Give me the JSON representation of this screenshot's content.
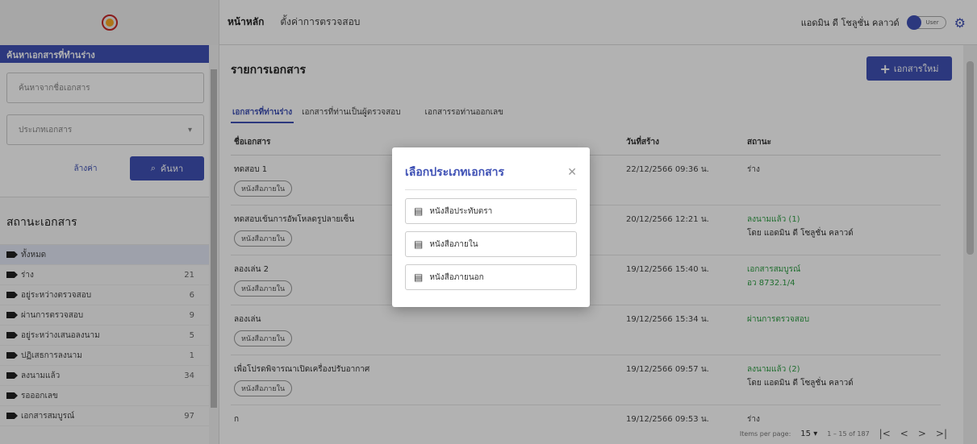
{
  "header": {
    "nav_tabs": [
      "หน้าหลัก",
      "ตั้งค่าการตรวจสอบ"
    ],
    "user_name": "แอดมิน ดี โชลูชั่น คลาวด์",
    "toggle_label": "User"
  },
  "sidebar": {
    "search_title": "ค้นหาเอกสารที่ทำนร่าง",
    "search_placeholder": "ค้นหาจากชื่อเอกสาร",
    "type_placeholder": "ประเภทเอกสาร",
    "clear_label": "ล้างค่า",
    "search_label": "ค้นหา",
    "status_title": "สถานะเอกสาร",
    "status_items": [
      {
        "label": "ทั้งหมด",
        "count": ""
      },
      {
        "label": "ร่าง",
        "count": "21"
      },
      {
        "label": "อยู่ระหว่างตรวจสอบ",
        "count": "6"
      },
      {
        "label": "ผ่านการตรวจสอบ",
        "count": "9"
      },
      {
        "label": "อยู่ระหว่างเสนอลงนาม",
        "count": "5"
      },
      {
        "label": "ปฏิเสธการลงนาม",
        "count": "1"
      },
      {
        "label": "ลงนามแล้ว",
        "count": "34"
      },
      {
        "label": "รอออกเลข",
        "count": ""
      },
      {
        "label": "เอกสารสมบูรณ์",
        "count": "97"
      }
    ]
  },
  "main": {
    "title": "รายการเอกสาร",
    "new_button": "เอกสารใหม่",
    "tabs": [
      "เอกสารที่ท่านร่าง",
      "เอกสารที่ท่านเป็นผู้ตรวจสอบ",
      "เอกสารรอท่านออกเลข"
    ],
    "columns": [
      "ชื่อเอกสาร",
      "วันที่สร้าง",
      "สถานะ"
    ],
    "rows": [
      {
        "name": "ทดสอบ 1",
        "chip": "หนังสือภายใน",
        "date": "22/12/2566 09:36 น.",
        "status": "ร่าง",
        "status_sub": ""
      },
      {
        "name": "ทดสอบเข้นการอัพโหลดรูปลายเซ็น",
        "chip": "หนังสือภายใน",
        "date": "20/12/2566 12:21 น.",
        "status": "ลงนามแล้ว (1)",
        "status_sub": "โดย แอดมิน ดี โซลูชั่น คลาวด์"
      },
      {
        "name": "ลองเล่น 2",
        "chip": "หนังสือภายใน",
        "date": "19/12/2566 15:40 น.",
        "status": "เอกสารสมบูรณ์",
        "status_sub": "อว 8732.1/4"
      },
      {
        "name": "ลองเล่น",
        "chip": "หนังสือภายใน",
        "date": "19/12/2566 15:34 น.",
        "status": "ผ่านการตรวจสอบ",
        "status_sub": ""
      },
      {
        "name": "เพื่อโปรดพิจารณาเปิดเครื่องปรับอากาศ",
        "chip": "หนังสือภายใน",
        "date": "19/12/2566 09:57 น.",
        "status": "ลงนามแล้ว (2)",
        "status_sub": "โดย แอดมิน ดี โซลูชั่น คลาวด์"
      },
      {
        "name": "ก",
        "chip": "",
        "date": "19/12/2566 09:53 น.",
        "status": "ร่าง",
        "status_sub": ""
      }
    ],
    "pager": {
      "items_label": "Items per page:",
      "per_page": "15",
      "range": "1 – 15 of 187"
    }
  },
  "dialog": {
    "title": "เลือกประเภทเอกสาร",
    "options": [
      "หนังสือประทับตรา",
      "หนังสือภายใน",
      "หนังสือภายนอก"
    ]
  },
  "colors": {
    "primary": "#3f51b5",
    "success": "#2e9e44"
  }
}
